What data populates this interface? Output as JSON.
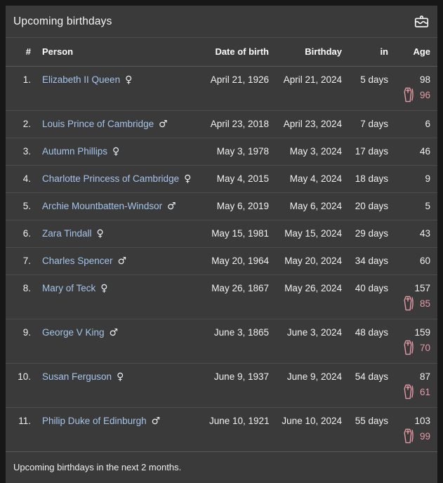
{
  "header": {
    "title": "Upcoming birthdays",
    "icon": "cake-icon"
  },
  "table": {
    "columns": [
      "#",
      "Person",
      "Date of birth",
      "Birthday",
      "in",
      "Age"
    ],
    "rows": [
      {
        "num": "1.",
        "person": "Elizabeth II Queen",
        "gender": "female",
        "dob": "April 21, 1926",
        "birthday": "April 21, 2024",
        "in": "5 days",
        "age": "98",
        "death_age": "96"
      },
      {
        "num": "2.",
        "person": "Louis Prince of Cambridge",
        "gender": "male",
        "dob": "April 23, 2018",
        "birthday": "April 23, 2024",
        "in": "7 days",
        "age": "6",
        "death_age": null
      },
      {
        "num": "3.",
        "person": "Autumn Phillips",
        "gender": "female",
        "dob": "May 3, 1978",
        "birthday": "May 3, 2024",
        "in": "17 days",
        "age": "46",
        "death_age": null
      },
      {
        "num": "4.",
        "person": "Charlotte Princess of Cambridge",
        "gender": "female",
        "dob": "May 4, 2015",
        "birthday": "May 4, 2024",
        "in": "18 days",
        "age": "9",
        "death_age": null
      },
      {
        "num": "5.",
        "person": "Archie Mountbatten-Windsor",
        "gender": "male",
        "dob": "May 6, 2019",
        "birthday": "May 6, 2024",
        "in": "20 days",
        "age": "5",
        "death_age": null
      },
      {
        "num": "6.",
        "person": "Zara Tindall",
        "gender": "female",
        "dob": "May 15, 1981",
        "birthday": "May 15, 2024",
        "in": "29 days",
        "age": "43",
        "death_age": null
      },
      {
        "num": "7.",
        "person": "Charles Spencer",
        "gender": "male",
        "dob": "May 20, 1964",
        "birthday": "May 20, 2024",
        "in": "34 days",
        "age": "60",
        "death_age": null
      },
      {
        "num": "8.",
        "person": "Mary of Teck",
        "gender": "female",
        "dob": "May 26, 1867",
        "birthday": "May 26, 2024",
        "in": "40 days",
        "age": "157",
        "death_age": "85"
      },
      {
        "num": "9.",
        "person": "George V King",
        "gender": "male",
        "dob": "June 3, 1865",
        "birthday": "June 3, 2024",
        "in": "48 days",
        "age": "159",
        "death_age": "70"
      },
      {
        "num": "10.",
        "person": "Susan Ferguson",
        "gender": "female",
        "dob": "June 9, 1937",
        "birthday": "June 9, 2024",
        "in": "54 days",
        "age": "87",
        "death_age": "61"
      },
      {
        "num": "11.",
        "person": "Philip Duke of Edinburgh",
        "gender": "male",
        "dob": "June 10, 1921",
        "birthday": "June 10, 2024",
        "in": "55 days",
        "age": "103",
        "death_age": "99"
      }
    ]
  },
  "icons": {
    "gender_female": "♀",
    "gender_male": "♂",
    "death_icon": "coffin-icon",
    "header_icon": "cake-icon"
  },
  "footer": {
    "note": "Upcoming birthdays in the next 2 months."
  },
  "colors": {
    "page_background": "#171717",
    "card_background": "#3a3a3a",
    "divider": "#4d4d4d",
    "text": "#f1f1f1",
    "link": "#a5c4ea",
    "deceased_accent": "#e59aa6"
  }
}
